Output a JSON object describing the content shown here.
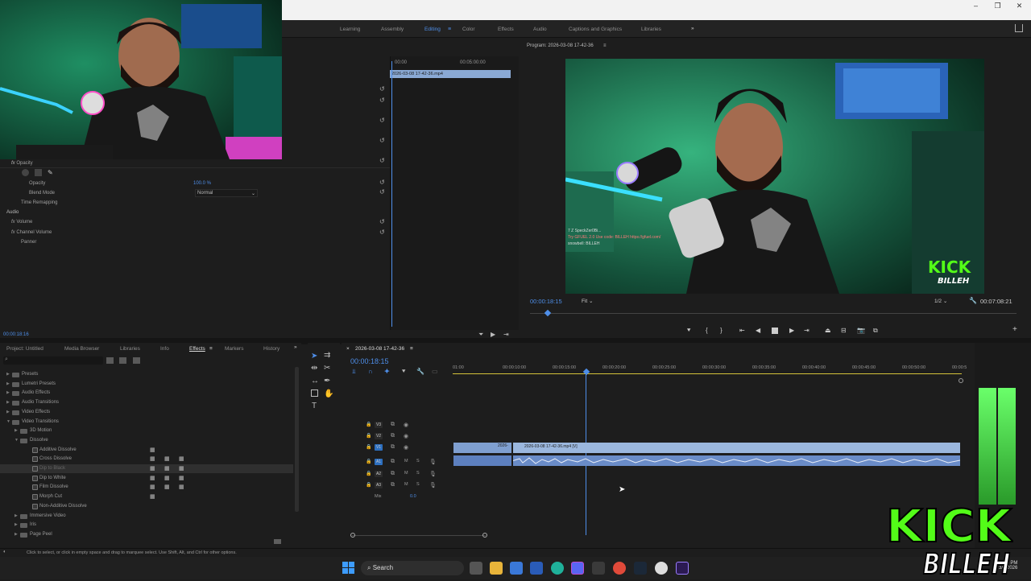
{
  "window": {
    "minimize": "–",
    "maximize": "❐",
    "close": "✕"
  },
  "workspaces": [
    "Learning",
    "Assembly",
    "Editing",
    "Color",
    "Effects",
    "Audio",
    "Captions and Graphics",
    "Libraries"
  ],
  "workspace_active": "Editing",
  "workspace_more": "»",
  "effect_controls": {
    "source_timecodes": [
      "00:00",
      "00:05:00:00"
    ],
    "clip_name": "2026-03-08 17-42-36.mp4",
    "rows": [
      {
        "label": "Opacity",
        "type": "section"
      },
      {
        "label": "Opacity",
        "value": "100.0 %"
      },
      {
        "label": "Blend Mode",
        "value": "Normal"
      },
      {
        "label": "Time Remapping"
      },
      {
        "label": "Audio",
        "type": "header"
      },
      {
        "label": "Volume"
      },
      {
        "label": "Channel Volume"
      },
      {
        "label": "Panner"
      }
    ],
    "fx_label": "fx",
    "current_time": "00:00:18:16"
  },
  "program": {
    "title": "Program: 2026-03-08 17-42-36",
    "timecode": "00:00:18:15",
    "fit": "Fit",
    "resolution": "1/2",
    "duration": "00:07:08:21",
    "chat_lines": [
      "7  Z SpeckZer0Bi...",
      "Try GFUEL 2.0 Use code: BILLEH https://gfuel.com/",
      "snowbell: BILLEH"
    ],
    "watermark": [
      "KICK",
      "BILLEH"
    ]
  },
  "panels": {
    "tabs": [
      "Project: Untitled",
      "Media Browser",
      "Libraries",
      "Info",
      "Effects",
      "Markers",
      "History"
    ],
    "active": "Effects",
    "more": "»"
  },
  "effects_tree": [
    {
      "label": "Presets",
      "level": 0,
      "folder": true
    },
    {
      "label": "Lumetri Presets",
      "level": 0,
      "folder": true
    },
    {
      "label": "Audio Effects",
      "level": 0,
      "folder": true
    },
    {
      "label": "Audio Transitions",
      "level": 0,
      "folder": true
    },
    {
      "label": "Video Effects",
      "level": 0,
      "folder": true
    },
    {
      "label": "Video Transitions",
      "level": 0,
      "folder": true,
      "open": true
    },
    {
      "label": "3D Motion",
      "level": 1,
      "folder": true
    },
    {
      "label": "Dissolve",
      "level": 1,
      "folder": true,
      "open": true
    },
    {
      "label": "Additive Dissolve",
      "level": 2,
      "badges": 1
    },
    {
      "label": "Cross Dissolve",
      "level": 2,
      "badges": 3
    },
    {
      "label": "Dip to Black",
      "level": 2,
      "badges": 3,
      "selected": true
    },
    {
      "label": "Dip to White",
      "level": 2,
      "badges": 3
    },
    {
      "label": "Film Dissolve",
      "level": 2,
      "badges": 3
    },
    {
      "label": "Morph Cut",
      "level": 2,
      "badges": 1
    },
    {
      "label": "Non-Additive Dissolve",
      "level": 2,
      "badges": 0
    },
    {
      "label": "Immersive Video",
      "level": 1,
      "folder": true
    },
    {
      "label": "Iris",
      "level": 1,
      "folder": true
    },
    {
      "label": "Page Peel",
      "level": 1,
      "folder": true
    }
  ],
  "timeline": {
    "sequence": "2026-03-08 17-42-36",
    "timecode": "00:00:18:15",
    "ruler": [
      "01:00",
      "00:00:10:00",
      "00:00:15:00",
      "00:00:20:00",
      "00:00:25:00",
      "00:00:30:00",
      "00:00:35:00",
      "00:00:40:00",
      "00:00:45:00",
      "00:00:50:00",
      "00:00:5"
    ],
    "tracks": [
      "V3",
      "V2",
      "V1",
      "A1",
      "A2",
      "A3"
    ],
    "mix_label": "Mix",
    "mix_value": "0.0",
    "clip_v_short": "2026-",
    "clip_v": "2026-03-08 17-42-36.mp4 [V]"
  },
  "status": "Click to select, or click in empty space and drag to marquee select. Use Shift, Alt, and Ctrl for other options.",
  "taskbar": {
    "search": "Search",
    "time": "5:50 PM",
    "date": "3/8/2026"
  },
  "colors": {
    "accent": "#4e8ee8",
    "clip_video": "#8aa9d4",
    "clip_audio": "#7f9fd0",
    "meter": "#34c23a"
  }
}
